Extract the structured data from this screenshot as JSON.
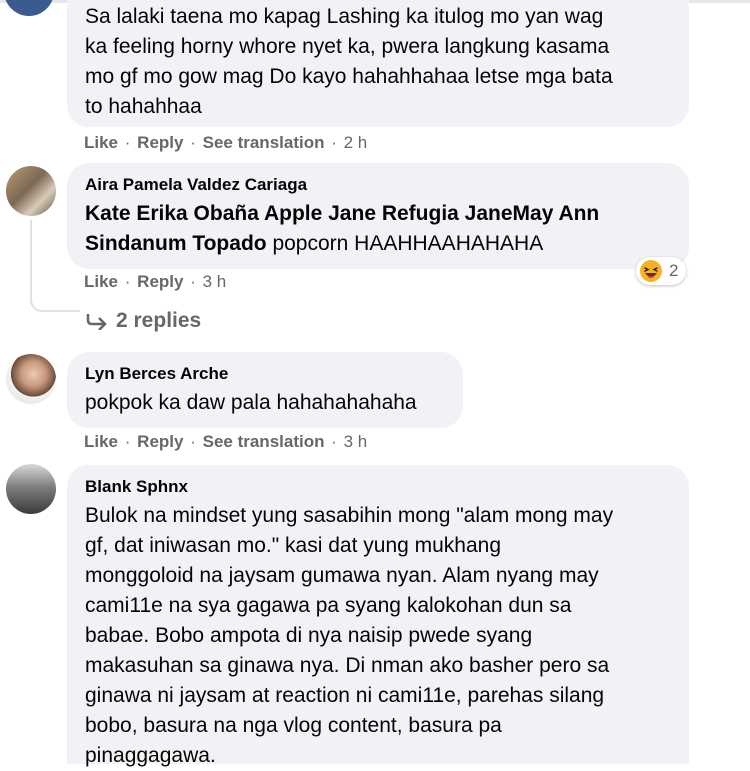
{
  "comments": [
    {
      "text": "Sa lalaki taena mo kapag Lashing ka itulog mo yan wag\nka feeling horny whore nyet ka, pwera langkung kasama\nmo gf mo gow mag Do kayo hahahhahaa letse mga bata\nto hahahhaa",
      "actions": {
        "like": "Like",
        "reply": "Reply",
        "translate": "See translation",
        "time": "2 h"
      }
    },
    {
      "author": "Aira Pamela Valdez Cariaga",
      "tagged": "Kate Erika Obaña Apple Jane Refugia JaneMay Ann\nSindanum Topado",
      "text": " popcorn HAAHHAAHAHAHA",
      "actions": {
        "like": "Like",
        "reply": "Reply",
        "time": "3 h"
      },
      "reaction": {
        "icon": "haha-emoji-icon",
        "count": "2"
      },
      "replies_label": "2 replies"
    },
    {
      "author": "Lyn Berces Arche",
      "text": "pokpok ka daw pala hahahahahaha",
      "actions": {
        "like": "Like",
        "reply": "Reply",
        "translate": "See translation",
        "time": "3 h"
      }
    },
    {
      "author": "Blank Sphnx",
      "text": "Bulok na mindset yung sasabihin mong \"alam mong may\ngf, dat iniwasan mo.\" kasi dat yung mukhang\nmonggoloid na jaysam gumawa nyan. Alam nyang may\ncami11e na sya gagawa pa syang kalokohan dun sa\nbabae. Bobo ampota di nya naisip pwede syang\nmakasuhan sa ginawa nya. Di nman ako basher pero sa\nginawa ni jaysam at reaction ni cami11e, parehas silang\nbobo, basura na nga vlog content, basura pa\npinaggagawa."
    }
  ],
  "separator": "·",
  "colors": {
    "bubble": "#f0f2f5",
    "meta": "#65676b",
    "text": "#050505"
  }
}
